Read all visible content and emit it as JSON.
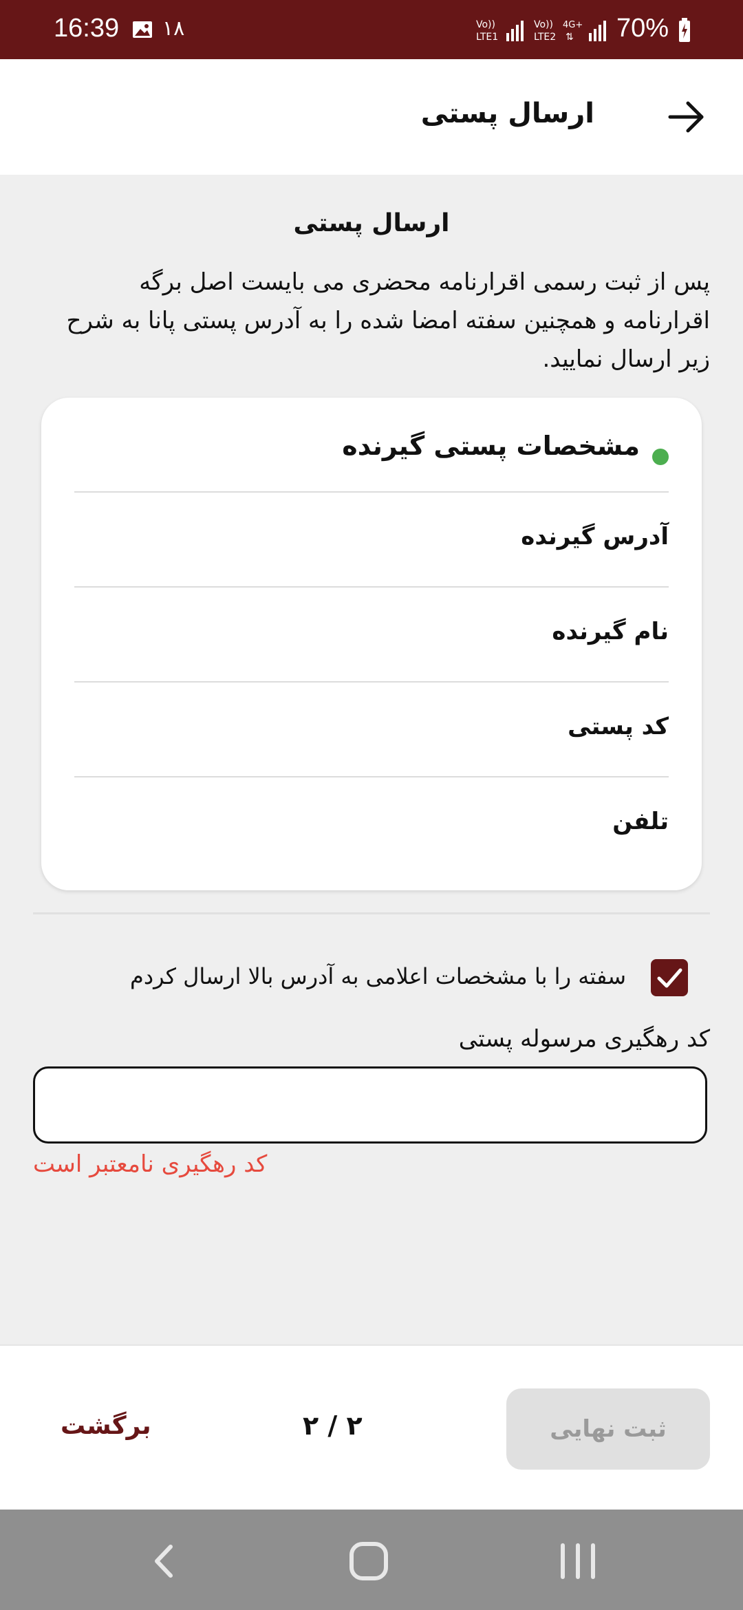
{
  "status_bar": {
    "time": "16:39",
    "notification_count": "۱۸",
    "battery": "70%"
  },
  "app_bar": {
    "title": "ارسال پستی"
  },
  "content": {
    "section_title": "ارسال پستی",
    "intro": "پس از ثبت رسمی اقرارنامه محضری می بایست اصل برگه اقرارنامه و همچنین سفته امضا شده را به آدرس پستی پانا به شرح زیر ارسال نمایید."
  },
  "card": {
    "title": "مشخصات پستی گیرنده",
    "rows": [
      {
        "label": "آدرس گیرنده"
      },
      {
        "label": "نام گیرنده"
      },
      {
        "label": "کد پستی"
      },
      {
        "label": "تلفن"
      }
    ]
  },
  "confirm": {
    "label": "سفته را با مشخصات اعلامی به آدرس بالا ارسال کردم",
    "checked": true
  },
  "tracking": {
    "label": "کد رهگیری مرسوله پستی",
    "value": "",
    "error": "کد رهگیری نامعتبر است"
  },
  "bottom_bar": {
    "submit_label": "ثبت نهایی",
    "page_indicator": "۲ / ۲",
    "back_label": "برگشت"
  },
  "colors": {
    "primary": "#661617",
    "accent_green": "#4cae4f",
    "error": "#e64a3e",
    "disabled": "#e0e0e0"
  }
}
